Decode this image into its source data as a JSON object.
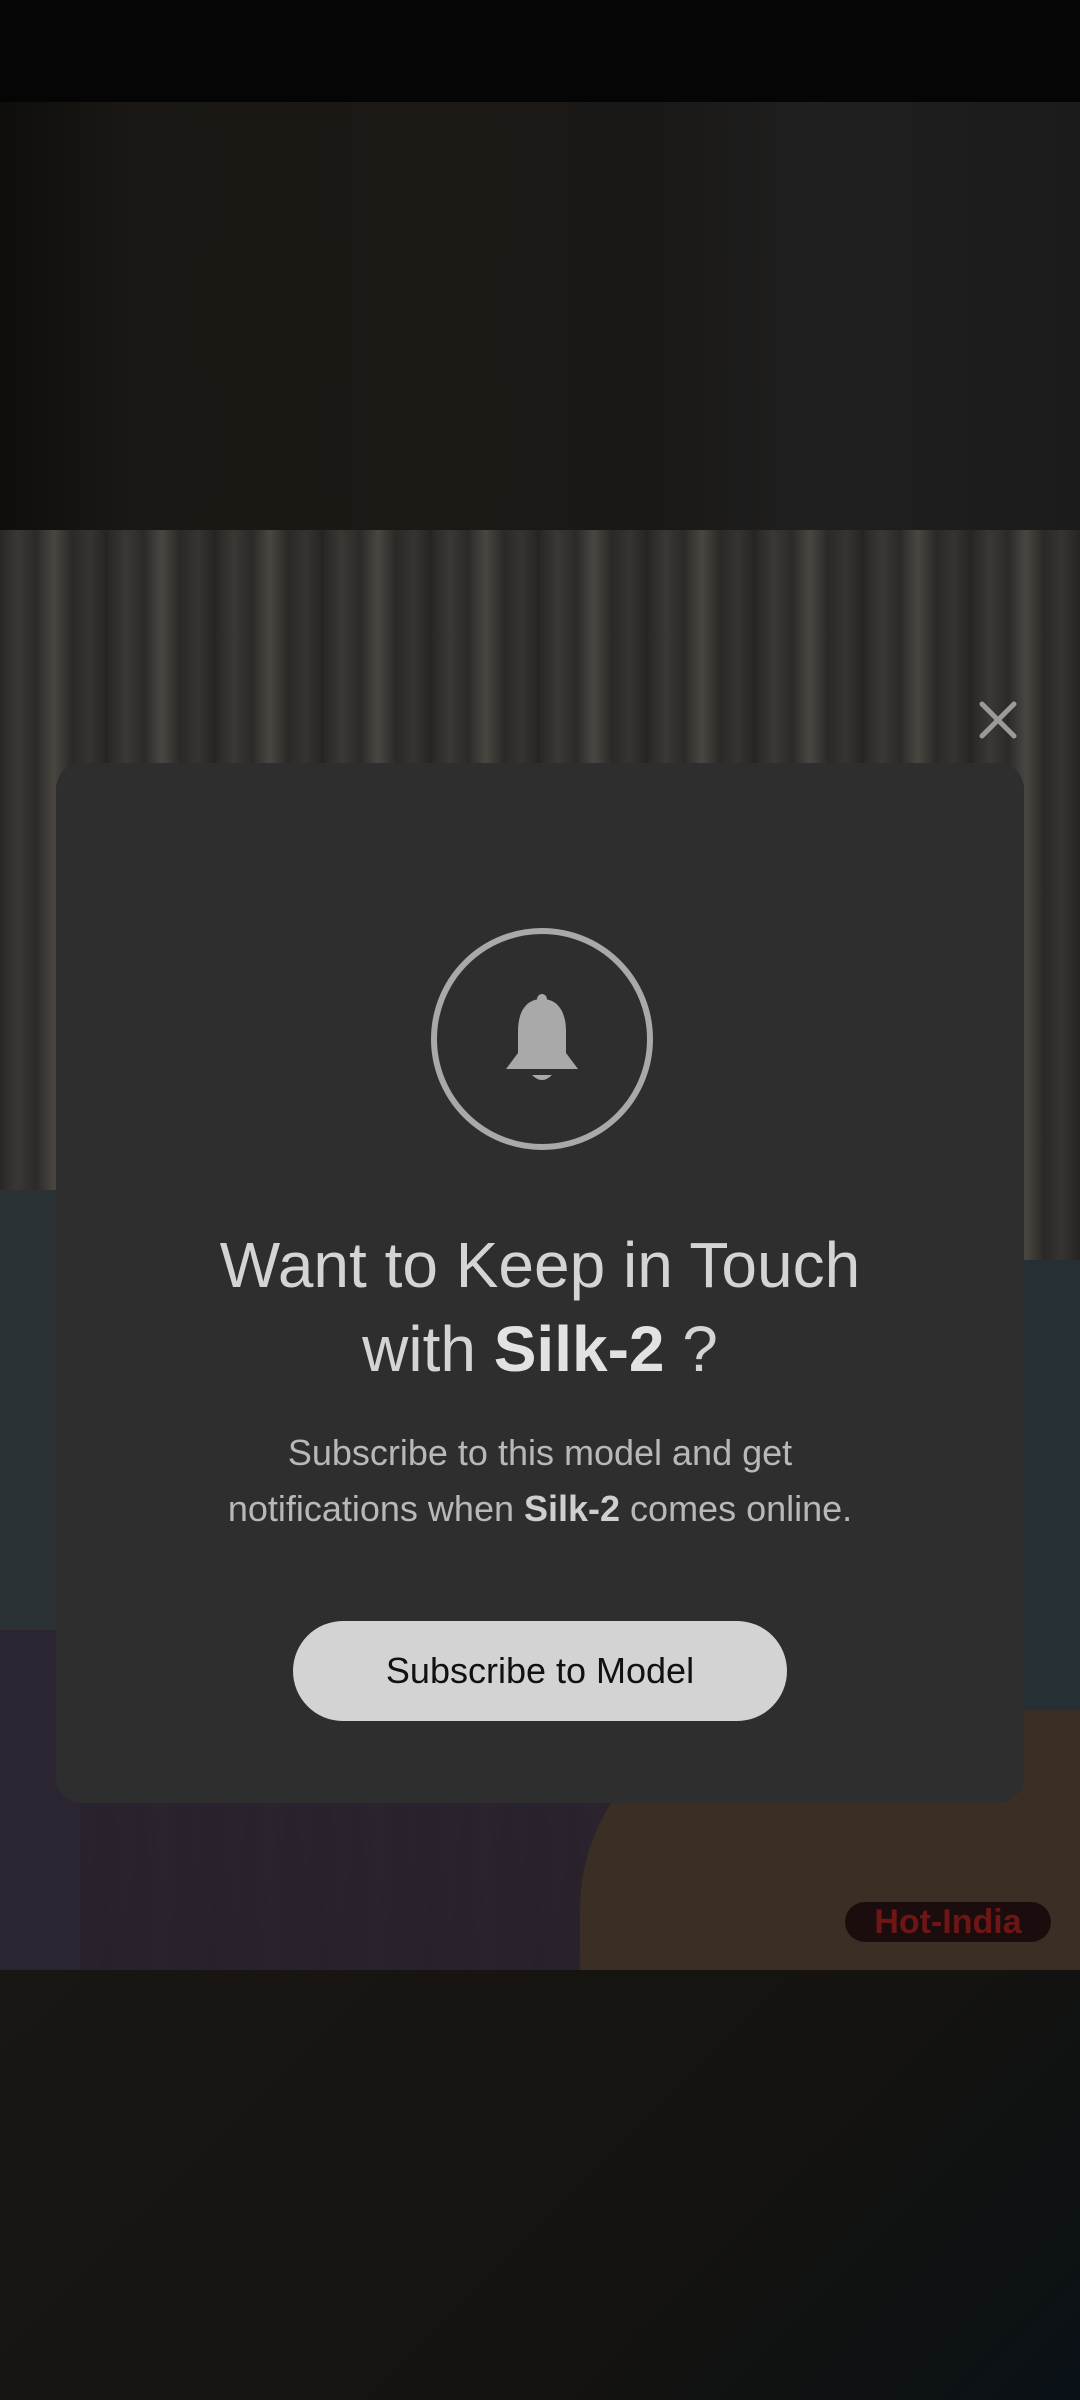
{
  "dialog": {
    "title_line1": "Want to Keep in Touch",
    "title_prefix": "with ",
    "model_name": "Silk-2",
    "title_suffix": " ?",
    "subtitle_line1": "Subscribe to this model and get",
    "subtitle_pre": "notifications when ",
    "subtitle_post": " comes online.",
    "subscribe_label": "Subscribe to Model",
    "bell_icon": "bell-icon",
    "close_icon": "close-icon"
  },
  "stream": {
    "watermark": "Hot-India"
  },
  "colors": {
    "modal_bg": "#2e2e2f",
    "button_bg": "#d3d3d3",
    "watermark_text": "#6e1616"
  }
}
